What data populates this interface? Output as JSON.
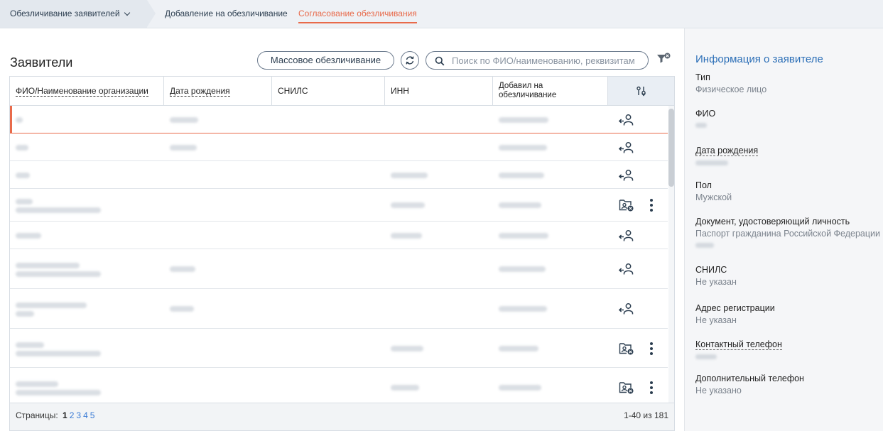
{
  "topnav": {
    "items": [
      {
        "label": "Обезличивание заявителей"
      },
      {
        "label": "Добавление на обезличивание"
      },
      {
        "label": "Согласование обезличивания"
      }
    ]
  },
  "main": {
    "title": "Заявители",
    "mass_button": "Массовое обезличивание",
    "search_placeholder": "Поиск по ФИО/наименованию, реквизитам"
  },
  "table": {
    "columns": [
      "ФИО/Наименование организации",
      "Дата рождения",
      "СНИЛС",
      "ИНН",
      "Добавил на обезличивание"
    ],
    "rows": [
      {
        "action": "return-user-icon",
        "menu": false,
        "selected": true
      },
      {
        "action": "return-user-icon",
        "menu": false,
        "selected": false
      },
      {
        "action": "return-user-icon",
        "menu": false,
        "selected": false
      },
      {
        "action": "folder-user-icon",
        "menu": true,
        "selected": false
      },
      {
        "action": "return-user-icon",
        "menu": false,
        "selected": false
      },
      {
        "action": "return-user-icon",
        "menu": false,
        "selected": false
      },
      {
        "action": "return-user-icon",
        "menu": false,
        "selected": false
      },
      {
        "action": "folder-user-icon",
        "menu": true,
        "selected": false
      },
      {
        "action": "folder-user-icon",
        "menu": true,
        "selected": false
      },
      {
        "action": "return-user-icon",
        "menu": false,
        "selected": false
      }
    ],
    "footer": {
      "pages_label": "Страницы:",
      "pages": [
        "1",
        "2",
        "3",
        "4",
        "5"
      ],
      "current_page": "1",
      "range": "1-40 из 181"
    }
  },
  "info": {
    "title": "Информация о заявителе",
    "fields": [
      {
        "label": "Тип",
        "value": "Физическое лицо"
      },
      {
        "label": "ФИО",
        "value": ""
      },
      {
        "label": "Дата рождения",
        "value": ""
      },
      {
        "label": "Пол",
        "value": "Мужской"
      },
      {
        "label": "Документ, удостоверяющий личность",
        "value": "Паспорт гражданина Российской Федерации"
      },
      {
        "label": "СНИЛС",
        "value": "Не указан"
      },
      {
        "label": "Адрес регистрации",
        "value": "Не указан"
      },
      {
        "label": "Контактный телефон",
        "value": ""
      },
      {
        "label": "Дополнительный телефон",
        "value": "Не указано"
      }
    ]
  },
  "colors": {
    "accent": "#e86a4a",
    "link": "#3a7bd5",
    "info_title": "#2c6fb7",
    "header_action_bg": "#e9eef4"
  }
}
